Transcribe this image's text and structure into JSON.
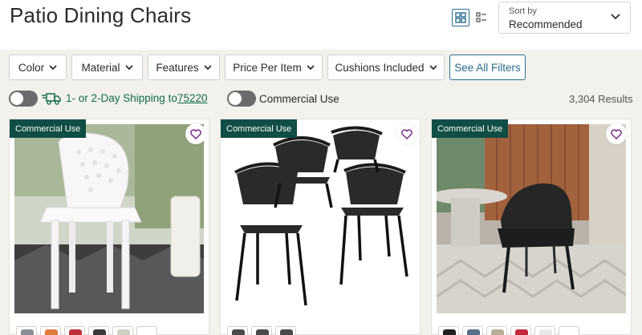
{
  "header": {
    "title": "Patio Dining Chairs",
    "grid_view_icon": "grid-view-icon",
    "list_view_icon": "list-view-icon"
  },
  "sort": {
    "label": "Sort by",
    "value": "Recommended"
  },
  "filters": [
    {
      "label": "Color"
    },
    {
      "label": "Material"
    },
    {
      "label": "Features"
    },
    {
      "label": "Price Per Item"
    },
    {
      "label": "Cushions Included"
    }
  ],
  "see_all_filters": "See All Filters",
  "shipping": {
    "text": "1- or 2-Day Shipping to",
    "zip": "75220",
    "enabled": false
  },
  "commercial_toggle": {
    "label": "Commercial Use",
    "enabled": false
  },
  "results_count": "3,304 Results",
  "colors": {
    "accent": "#2b6e8f",
    "badge": "#0f4d45",
    "shipping_green": "#0f6d4a",
    "heart": "#7a2d8c",
    "toggle_off": "#6b6b6b"
  },
  "products": [
    {
      "badge": "Commercial Use",
      "swatch_colors": [
        "#8a8f96",
        "#e07a3c",
        "#c0303a",
        "#3a3a3a",
        "#cfcfc4"
      ]
    },
    {
      "badge": "Commercial Use",
      "swatch_colors": [
        "#4a4a4a",
        "#4a4a4a",
        "#4a4a4a"
      ]
    },
    {
      "badge": "Commercial Use",
      "swatch_colors": [
        "#1f1f1f",
        "#5a6f8a",
        "#b8ad98",
        "#c02a3a",
        "#e8e8e8"
      ]
    }
  ]
}
